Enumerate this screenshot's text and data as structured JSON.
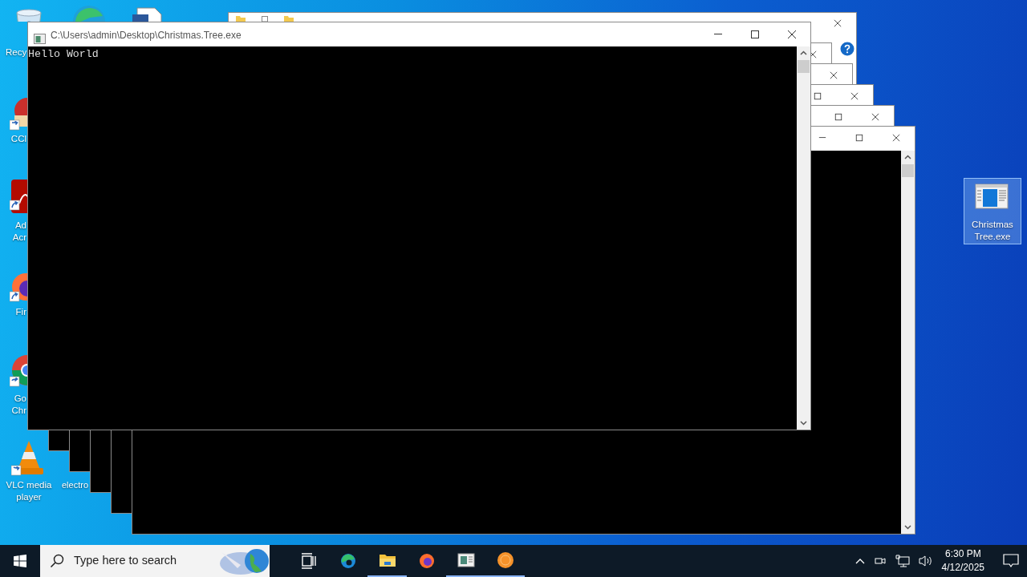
{
  "desktop": {
    "icons": [
      {
        "kind": "recycle-bin",
        "label_lines": [
          "Recy"
        ],
        "selected": false
      },
      {
        "kind": "edge",
        "selected": false
      },
      {
        "kind": "document",
        "selected": false
      },
      {
        "kind": "ccleaner",
        "label_lines": [
          "CCl"
        ],
        "selected": false
      },
      {
        "kind": "acrobat",
        "label_lines": [
          "Ad",
          "Acr"
        ],
        "selected": false
      },
      {
        "kind": "firefox",
        "label_lines": [
          "Fir"
        ],
        "selected": false
      },
      {
        "kind": "chrome",
        "label_lines": [
          "Go",
          "Chr"
        ],
        "selected": false
      },
      {
        "kind": "vlc",
        "label_lines": [
          "VLC media",
          "player"
        ],
        "selected": false
      },
      {
        "kind": "electron",
        "label_lines": [
          "electro"
        ],
        "selected": false
      },
      {
        "kind": "program",
        "label_lines": [
          "Christmas",
          "Tree.exe"
        ],
        "selected": true
      }
    ]
  },
  "windows": [
    {
      "kind": "explorer",
      "controls": [
        {
          "kind": "close"
        }
      ],
      "help": true
    },
    {
      "kind": "console",
      "controls": [
        {
          "kind": "close"
        }
      ]
    },
    {
      "kind": "console",
      "controls": [
        {
          "kind": "close"
        }
      ]
    },
    {
      "kind": "console",
      "controls": [
        {
          "kind": "restore"
        },
        {
          "kind": "close"
        }
      ]
    },
    {
      "kind": "console",
      "controls": [
        {
          "kind": "restore"
        },
        {
          "kind": "close"
        }
      ]
    },
    {
      "kind": "console",
      "controls": [
        {
          "kind": "minimize"
        },
        {
          "kind": "restore"
        },
        {
          "kind": "close"
        }
      ],
      "scrollbar": true
    },
    {
      "kind": "console",
      "title": "C:\\Users\\admin\\Desktop\\Christmas.Tree.exe",
      "output": "Hello World",
      "controls": [
        {
          "kind": "minimize"
        },
        {
          "kind": "restore"
        },
        {
          "kind": "close"
        }
      ],
      "scrollbar": true
    }
  ],
  "taskbar": {
    "search": {
      "placeholder": "Type here to search"
    },
    "apps": [
      {
        "kind": "task-view",
        "active": false
      },
      {
        "kind": "edge",
        "active": false
      },
      {
        "kind": "explorer",
        "active": true
      },
      {
        "kind": "firefox",
        "active": false
      },
      {
        "kind": "console",
        "active": true
      },
      {
        "kind": "orange-app",
        "active": true
      }
    ],
    "clock": {
      "time": "6:30 PM",
      "date": "4/12/2025"
    }
  }
}
